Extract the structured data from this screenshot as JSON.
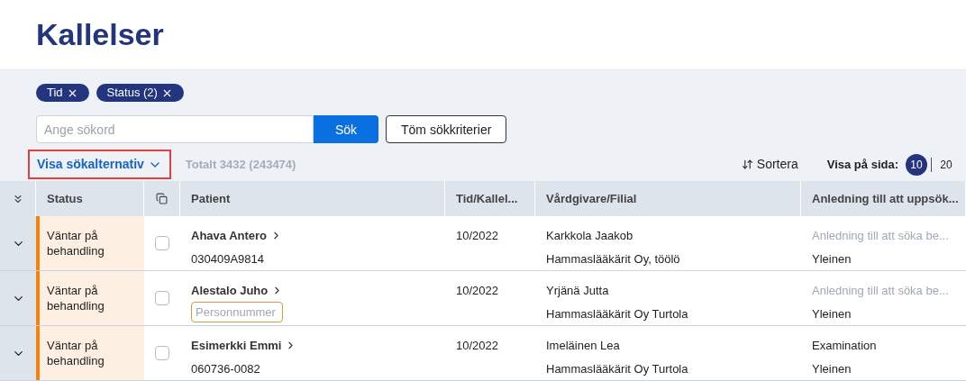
{
  "title": "Kallelser",
  "filters": [
    {
      "label": "Tid"
    },
    {
      "label": "Status (2)"
    }
  ],
  "search": {
    "placeholder": "Ange sökord",
    "button": "Sök",
    "clear_button": "Töm sökkriterier"
  },
  "options_toggle": {
    "label": "Visa sökalternativ",
    "highlighted": true
  },
  "total": "Totalt 3432 (243474)",
  "sort": "Sortera",
  "page_size": {
    "label": "Visa på sida:",
    "options": [
      {
        "label": "10",
        "selected": true
      },
      {
        "label": "20",
        "selected": false
      }
    ]
  },
  "table": {
    "columns": [
      "Status",
      "Patient",
      "Tid/Kallel...",
      "Vårdgivare/Filial",
      "Anledning till att uppsök..."
    ],
    "rows": [
      {
        "status": "Väntar på behandling",
        "color": "#f5820d",
        "checked": false,
        "patient": "Ahava Antero",
        "id": {
          "kind": "text",
          "text": "030409A9814"
        },
        "time": "10/2022",
        "provider": "Karkkola Jaakob",
        "branch": "Hammaslääkärit Oy, töölö",
        "reason": {
          "text": "Anledning till att söka be...",
          "muted": true
        },
        "reason_type": "Yleinen"
      },
      {
        "status": "Väntar på behandling",
        "color": "#f5820d",
        "checked": false,
        "patient": "Alestalo Juho",
        "id": {
          "kind": "field",
          "placeholder": "Personnummer"
        },
        "time": "10/2022",
        "provider": "Yrjänä Jutta",
        "branch": "Hammaslääkärit Oy Turtola",
        "reason": {
          "text": "Anledning till att söka be...",
          "muted": true
        },
        "reason_type": "Yleinen"
      },
      {
        "status": "Väntar på behandling",
        "color": "#f5820d",
        "checked": false,
        "patient": "Esimerkki Emmi",
        "id": {
          "kind": "text",
          "text": "060736-0082"
        },
        "time": "10/2022",
        "provider": "Imeläinen Lea",
        "branch": "Hammaslääkärit Oy Turtola",
        "reason": {
          "text": "Examination",
          "muted": false
        },
        "reason_type": "Yleinen"
      }
    ]
  }
}
